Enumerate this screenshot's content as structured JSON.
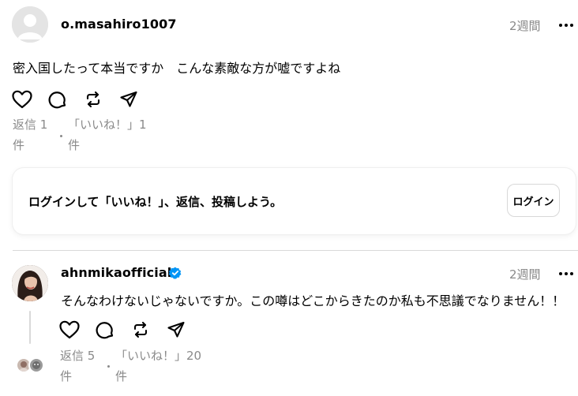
{
  "post1": {
    "username": "o.masahiro1007",
    "timestamp": "2週間",
    "text": "密入国したって本当ですか　こんな素敵な方が嘘ですよね",
    "replies_line1": "返信 1",
    "replies_line2": "件",
    "likes_line1": "「いいね！」1",
    "likes_line2": "件"
  },
  "login_prompt": {
    "text": "ログインして「いいね！」、返信、投稿しよう。",
    "button": "ログイン"
  },
  "post2": {
    "username": "ahnmikaofficial",
    "verified": true,
    "timestamp": "2週間",
    "text": "そんなわけないじゃないですか。この噂はどこからきたのか私も不思議でなりません！！",
    "replies_line1": "返信 5",
    "replies_line2": "件",
    "likes_line1": "「いいね！」20",
    "likes_line2": "件"
  },
  "icons": {
    "like": "heart-icon",
    "reply": "comment-icon",
    "repost": "repost-icon",
    "share": "send-icon",
    "more": "more-icon"
  },
  "colors": {
    "verified": "#0095f6",
    "muted_text": "#8a8a8a"
  }
}
